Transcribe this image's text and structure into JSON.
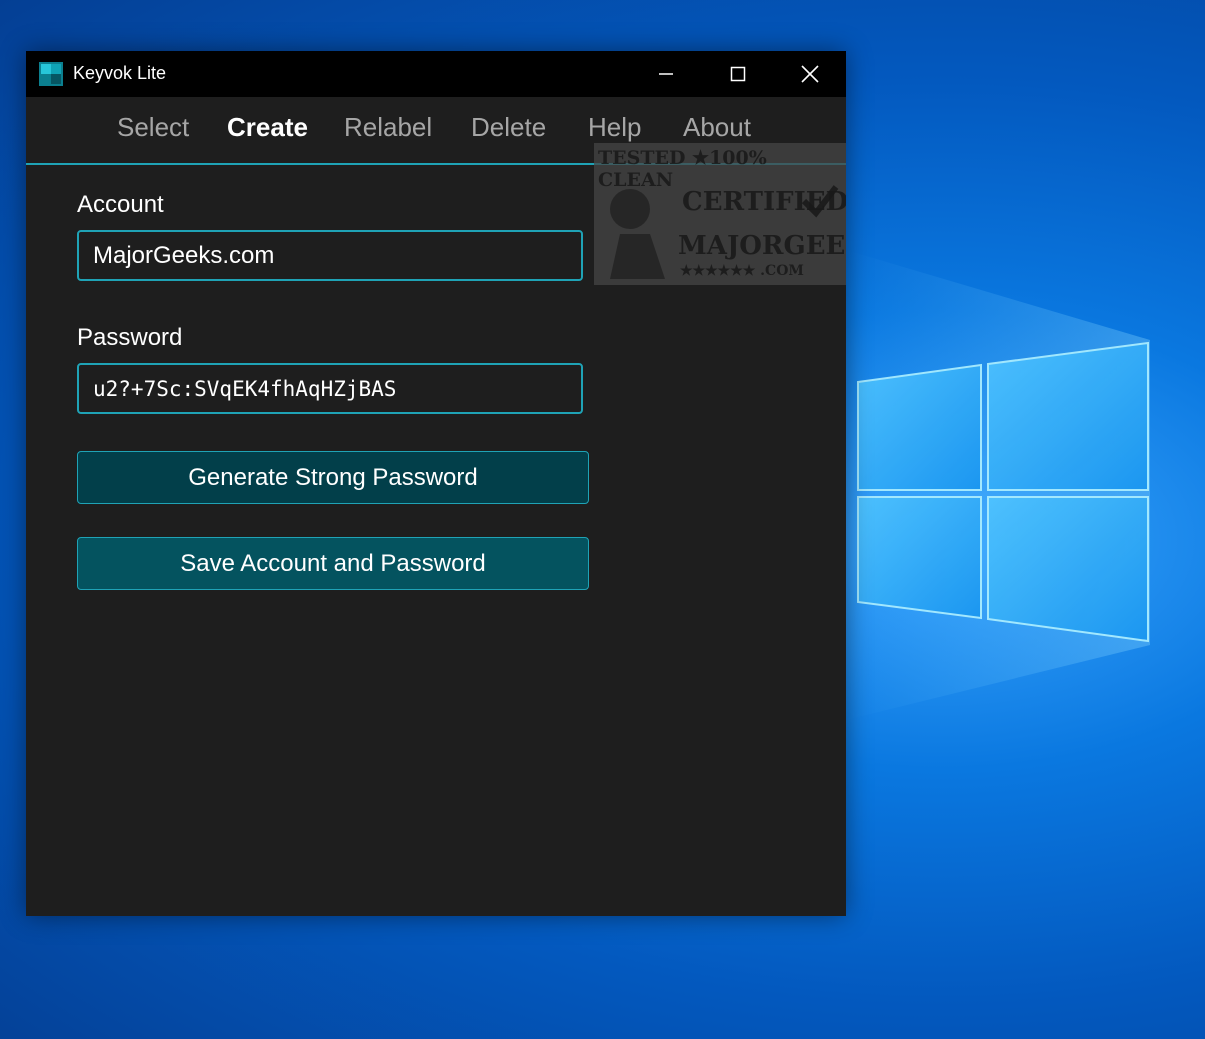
{
  "window": {
    "title": "Keyvok Lite",
    "icons": {
      "app": "keyvok-app-icon",
      "minimize": "minimize-icon",
      "maximize": "maximize-icon",
      "close": "close-icon"
    }
  },
  "menu": {
    "items": [
      {
        "label": "Select",
        "active": false
      },
      {
        "label": "Create",
        "active": true
      },
      {
        "label": "Relabel",
        "active": false
      },
      {
        "label": "Delete",
        "active": false
      },
      {
        "label": "Help",
        "active": false
      },
      {
        "label": "About",
        "active": false
      }
    ]
  },
  "form": {
    "account_label": "Account",
    "account_value": "MajorGeeks.com",
    "password_label": "Password",
    "password_value": "u2?+7Sc:SVqEK4fhAqHZjBAS",
    "generate_button": "Generate Strong Password",
    "save_button": "Save Account and Password"
  },
  "watermark": {
    "line1": "TESTED ★100% CLEAN",
    "line2": "CERTIFIED",
    "line3": "MAJORGEEKS",
    "line4": "★★★★★★ .COM"
  },
  "colors": {
    "accent": "#1fa3b6",
    "window_bg": "#1e1e1e",
    "titlebar_bg": "#000000",
    "generate_bg": "#023f4a",
    "save_bg": "#04535f"
  }
}
